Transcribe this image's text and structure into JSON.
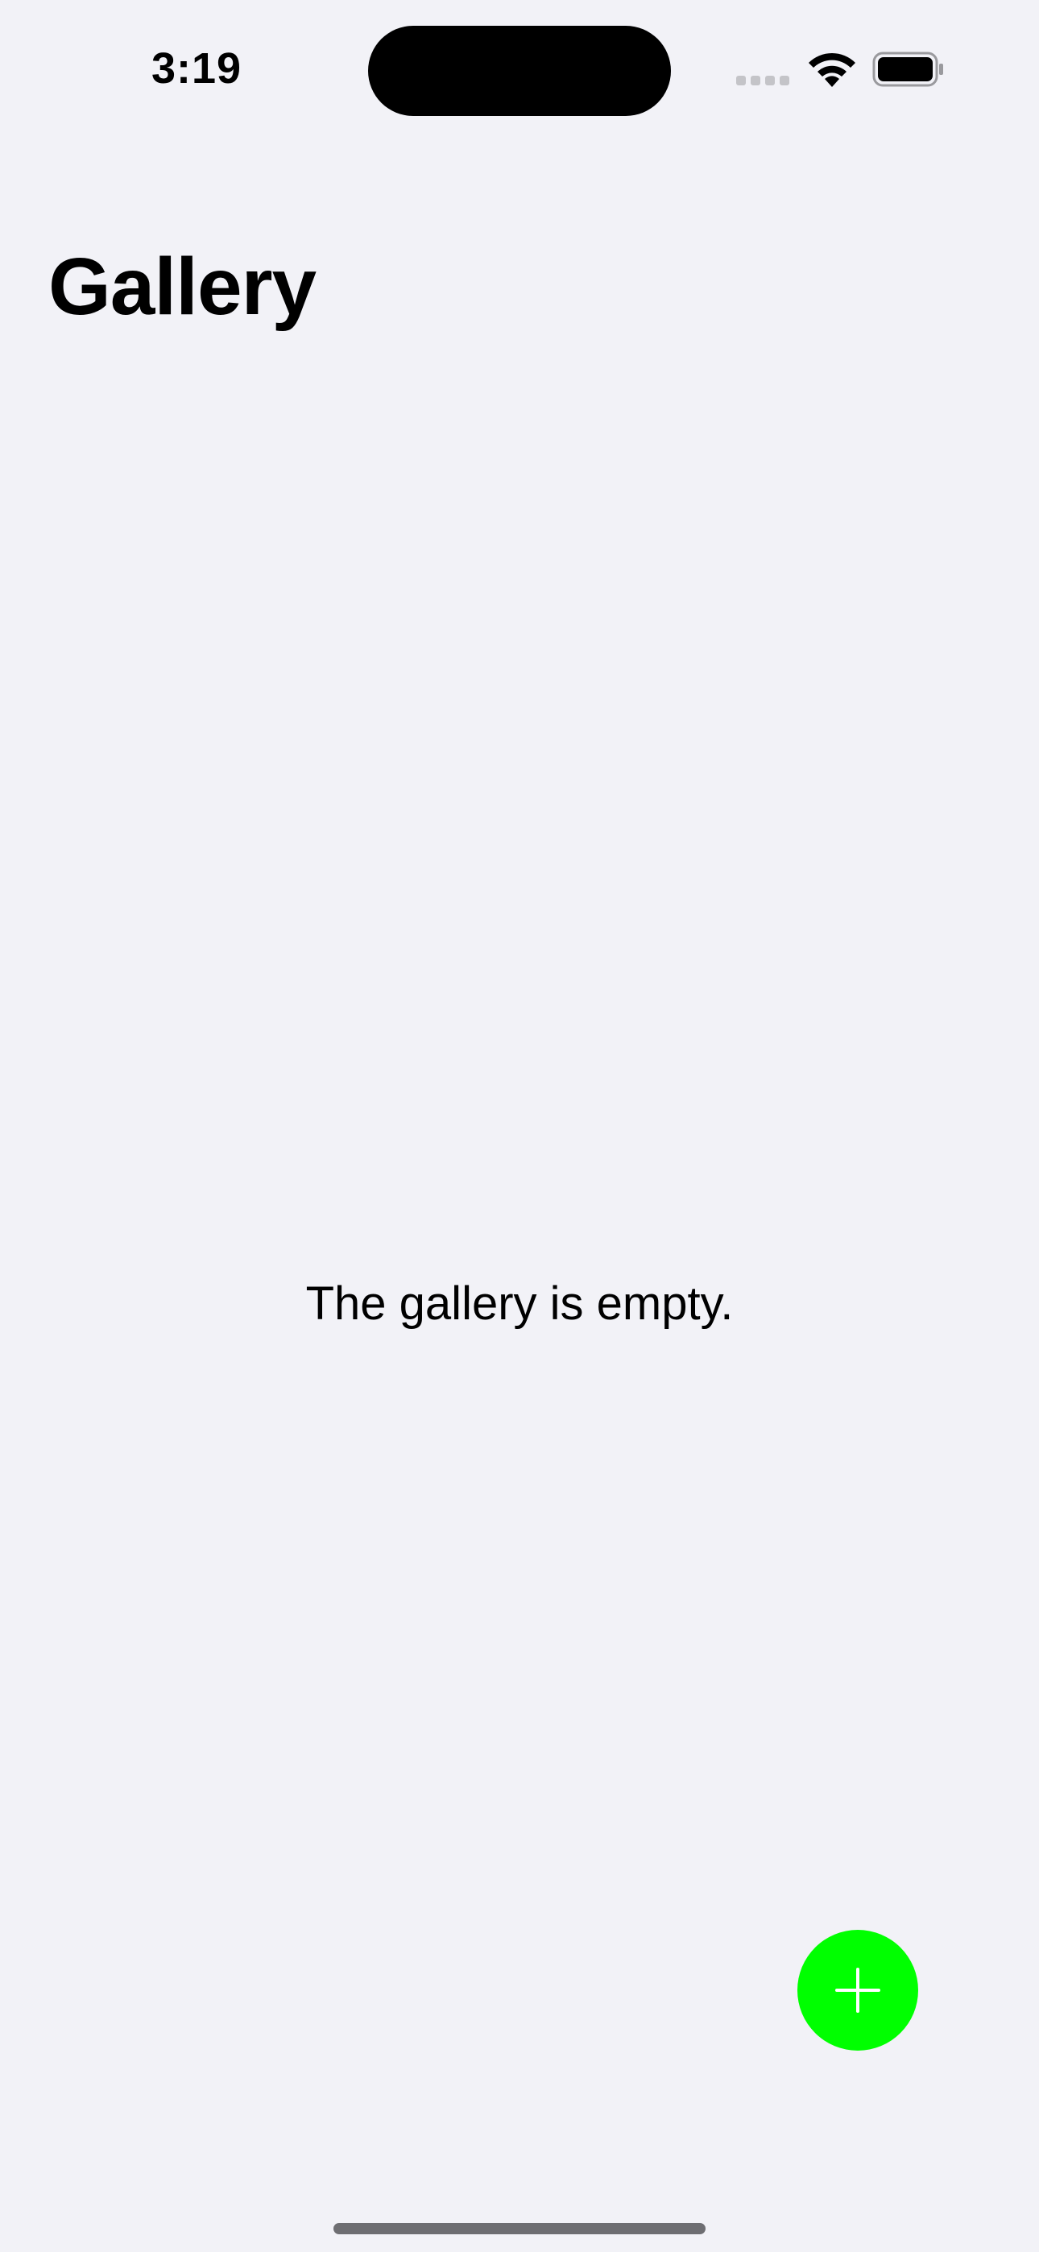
{
  "status_bar": {
    "time": "3:19",
    "icons": [
      "cellular-signal-icon",
      "wifi-icon",
      "battery-icon"
    ]
  },
  "header": {
    "title": "Gallery"
  },
  "main": {
    "empty_message": "The gallery is empty."
  },
  "fab": {
    "icon": "plus-icon",
    "color": "#00ff00",
    "icon_color": "#ffffff"
  },
  "colors": {
    "background": "#f2f2f7",
    "text": "#000000"
  }
}
